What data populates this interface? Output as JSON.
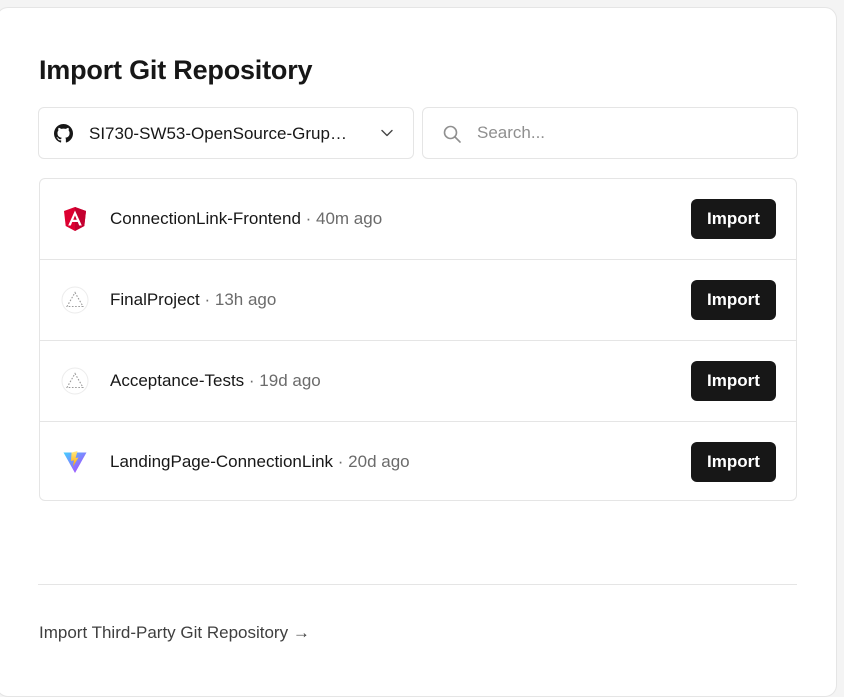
{
  "page": {
    "title": "Import Git Repository"
  },
  "scope": {
    "selected": "SI730-SW53-OpenSource-Grup…",
    "icon": "github-icon"
  },
  "search": {
    "placeholder": "Search...",
    "value": ""
  },
  "repos": [
    {
      "name": "ConnectionLink-Frontend",
      "separator": " · ",
      "time": "40m ago",
      "icon": "angular-icon",
      "button": "Import"
    },
    {
      "name": "FinalProject",
      "separator": " · ",
      "time": "13h ago",
      "icon": "vercel-triangle-icon",
      "button": "Import"
    },
    {
      "name": "Acceptance-Tests",
      "separator": " · ",
      "time": "19d ago",
      "icon": "vercel-triangle-icon",
      "button": "Import"
    },
    {
      "name": "LandingPage-ConnectionLink",
      "separator": " · ",
      "time": "20d ago",
      "icon": "vite-icon",
      "button": "Import"
    }
  ],
  "footer": {
    "third_party_link": "Import Third-Party Git Repository →"
  },
  "colors": {
    "button_bg": "#171717",
    "border": "#e5e5e5",
    "angular": "#dd0031",
    "vite_purple": "#9b59ff",
    "vite_yellow": "#ffd62e"
  }
}
